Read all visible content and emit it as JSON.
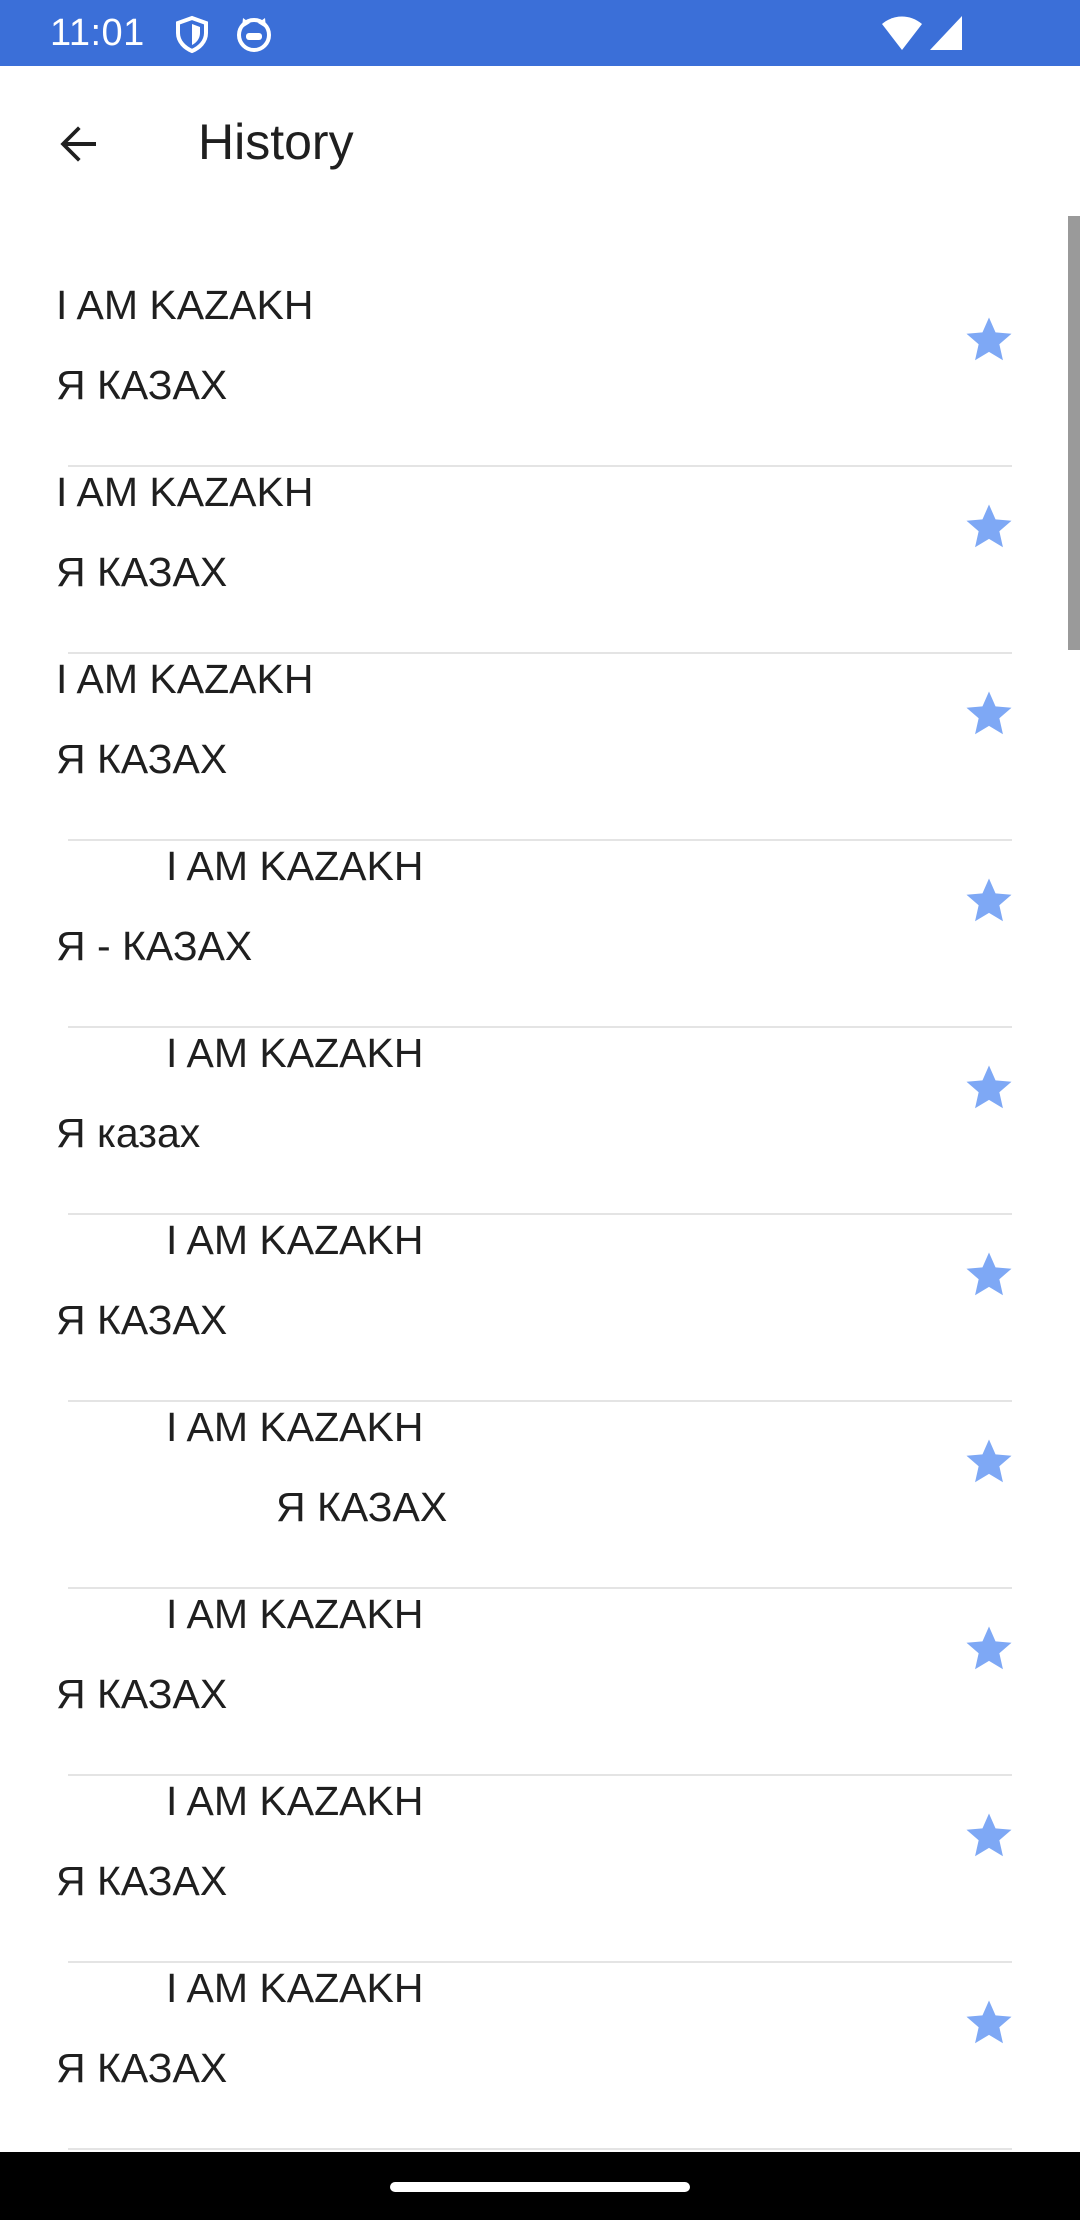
{
  "status_bar": {
    "time": "11:01",
    "left_icons": [
      "shield-icon",
      "cat-icon"
    ],
    "right_icons": [
      "wifi-icon",
      "signal-icon"
    ],
    "background": "#3b6fd8"
  },
  "app_bar": {
    "title": "History",
    "back_icon": "arrow-back-icon"
  },
  "accent_color": "#7ea8f5",
  "history": [
    {
      "source": " I AM KAZAKH",
      "translation": "Я КАЗАХ",
      "favorite": true
    },
    {
      "source": " I AM KAZAKH",
      "translation": "Я КАЗАХ",
      "favorite": true
    },
    {
      "source": " I AM KAZAKH",
      "translation": "Я КАЗАХ",
      "favorite": true
    },
    {
      "source": "I AM KAZAKH",
      "translation": "Я - КАЗАХ",
      "favorite": true
    },
    {
      "source": "I AM KAZAKH",
      "translation": "Я казах",
      "favorite": true
    },
    {
      "source": "I AM KAZAKH",
      "translation": "Я КАЗАХ",
      "favorite": true
    },
    {
      "source": "I AM KAZAKH",
      "translation": "Я КАЗАХ",
      "favorite": true
    },
    {
      "source": "I AM KAZAKH",
      "translation": "Я КАЗАХ",
      "favorite": true
    },
    {
      "source": "I AM KAZAKH",
      "translation": "Я КАЗАХ",
      "favorite": true
    },
    {
      "source": "I AM KAZAKH",
      "translation": "Я КАЗАХ",
      "favorite": true
    }
  ]
}
